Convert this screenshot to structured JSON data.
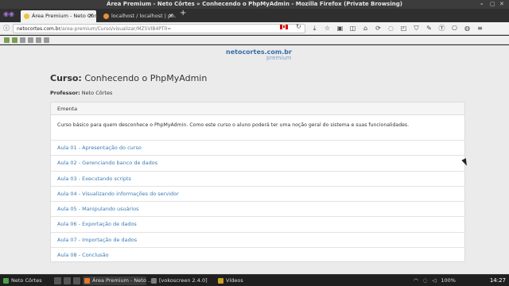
{
  "window": {
    "title": "Área Premium - Neto Côrtes » Conhecendo o PhpMyAdmin - Mozilla Firefox (Private Browsing)",
    "controls": [
      "–",
      "▢",
      "✕"
    ]
  },
  "tabs": [
    {
      "label": "Área Premium - Neto Côr...",
      "active": true
    },
    {
      "label": "localhost / localhost | ph...",
      "active": false
    }
  ],
  "newtab_label": "+",
  "urlbar": {
    "host": "netocortes.com.br",
    "path": "/area-premium/Curso/visualizar/MZ5VIB4PT0="
  },
  "page": {
    "logo_main": "netocortes.com.br",
    "logo_sub": "premium",
    "course_label": "Curso:",
    "course_name": "Conhecendo o PhpMyAdmin",
    "professor_label": "Professor:",
    "professor_name": "Neto Côrtes",
    "panel_heading": "Ementa",
    "description": "Curso básico para quem desconhece o PhpMyAdmin. Como este curso o aluno poderá ter uma noção geral do sistema e suas funcionalidades.",
    "lessons": [
      "Aula 01 - Apresentação do curso",
      "Aula 02 - Gerenciando banco de dados",
      "Aula 03 - Executando scripts",
      "Aula 04 - Visualizando informações do servidor",
      "Aula 05 - Manipulando usuários",
      "Aula 06 - Exportação de dados",
      "Aula 07 - Importação de dados",
      "Aula 08 - Conclusão"
    ]
  },
  "taskbar": {
    "start_label": "Neto Côrtes",
    "items": [
      {
        "label": "Área Premium - Neto ...",
        "active": true
      },
      {
        "label": "[vokoscreen 2.4.0]",
        "active": false
      },
      {
        "label": "Vídeos",
        "active": false
      }
    ],
    "battery": "100%",
    "clock": "14:27"
  },
  "colors": {
    "link": "#3b7bb6",
    "page_bg": "#ebebeb"
  }
}
